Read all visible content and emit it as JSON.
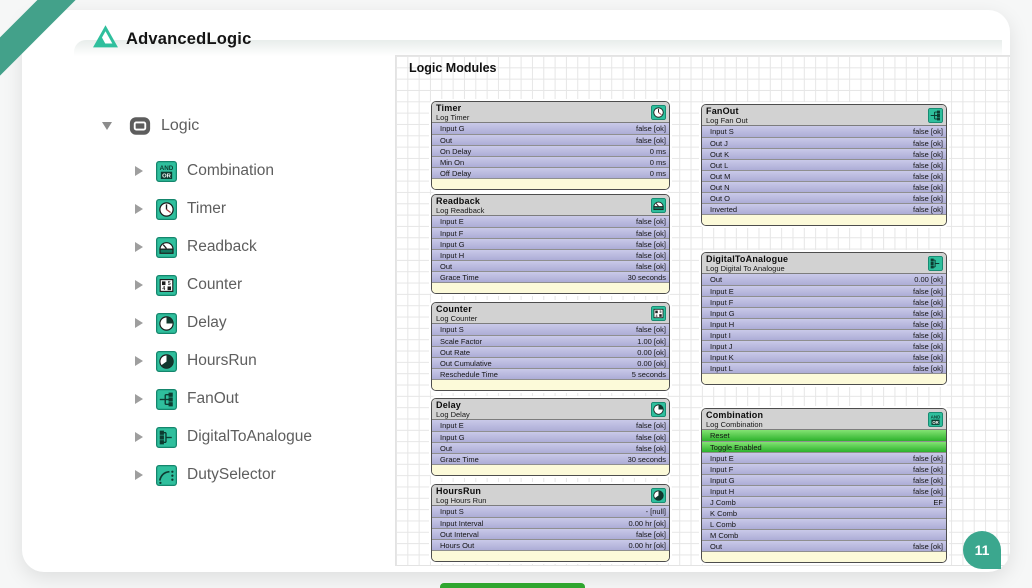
{
  "brand": {
    "name": "AdvancedLogic"
  },
  "slide": {
    "page_number": "11"
  },
  "tree": {
    "root": {
      "label": "Logic",
      "icon": "folder-icon"
    },
    "items": [
      {
        "label": "Combination",
        "icon": "andor-icon"
      },
      {
        "label": "Timer",
        "icon": "timer-icon"
      },
      {
        "label": "Readback",
        "icon": "readback-icon"
      },
      {
        "label": "Counter",
        "icon": "counter-icon"
      },
      {
        "label": "Delay",
        "icon": "delay-icon"
      },
      {
        "label": "HoursRun",
        "icon": "hoursrun-icon"
      },
      {
        "label": "FanOut",
        "icon": "fanout-icon"
      },
      {
        "label": "DigitalToAnalogue",
        "icon": "dta-icon"
      },
      {
        "label": "DutySelector",
        "icon": "dutyselector-icon"
      }
    ]
  },
  "canvas": {
    "title": "Logic Modules",
    "blocks": [
      {
        "name": "Timer",
        "subtitle": "Log Timer",
        "icon": "timer-icon",
        "rows": [
          {
            "label": "Input G",
            "value": "false [ok]"
          },
          {
            "label": "Out",
            "value": "false [ok]"
          },
          {
            "label": "On Delay",
            "value": "0 ms"
          },
          {
            "label": "Min On",
            "value": "0 ms"
          },
          {
            "label": "Off Delay",
            "value": "0 ms"
          }
        ]
      },
      {
        "name": "Readback",
        "subtitle": "Log Readback",
        "icon": "readback-icon",
        "rows": [
          {
            "label": "Input E",
            "value": "false [ok]"
          },
          {
            "label": "Input F",
            "value": "false [ok]"
          },
          {
            "label": "Input G",
            "value": "false [ok]"
          },
          {
            "label": "Input H",
            "value": "false [ok]"
          },
          {
            "label": "Out",
            "value": "false [ok]"
          },
          {
            "label": "Grace Time",
            "value": "30 seconds"
          }
        ]
      },
      {
        "name": "Counter",
        "subtitle": "Log Counter",
        "icon": "counter-icon",
        "rows": [
          {
            "label": "Input S",
            "value": "false [ok]"
          },
          {
            "label": "Scale Factor",
            "value": "1.00 [ok]"
          },
          {
            "label": "Out Rate",
            "value": "0.00 [ok]"
          },
          {
            "label": "Out Cumulative",
            "value": "0.00 [ok]"
          },
          {
            "label": "Reschedule Time",
            "value": "5 seconds"
          }
        ]
      },
      {
        "name": "Delay",
        "subtitle": "Log Delay",
        "icon": "delay-icon",
        "rows": [
          {
            "label": "Input E",
            "value": "false [ok]"
          },
          {
            "label": "Input G",
            "value": "false [ok]"
          },
          {
            "label": "Out",
            "value": "false [ok]"
          },
          {
            "label": "Grace Time",
            "value": "30 seconds"
          }
        ]
      },
      {
        "name": "HoursRun",
        "subtitle": "Log Hours Run",
        "icon": "hoursrun-icon",
        "rows": [
          {
            "label": "Input S",
            "value": "- [null]"
          },
          {
            "label": "Input Interval",
            "value": "0.00 hr [ok]"
          },
          {
            "label": "Out Interval",
            "value": "false [ok]"
          },
          {
            "label": "Hours Out",
            "value": "0.00 hr [ok]"
          }
        ]
      },
      {
        "name": "FanOut",
        "subtitle": "Log Fan Out",
        "icon": "fanout-icon",
        "rows": [
          {
            "label": "Input S",
            "value": "false [ok]"
          },
          {
            "label": "Out J",
            "value": "false [ok]"
          },
          {
            "label": "Out K",
            "value": "false [ok]"
          },
          {
            "label": "Out L",
            "value": "false [ok]"
          },
          {
            "label": "Out M",
            "value": "false [ok]"
          },
          {
            "label": "Out N",
            "value": "false [ok]"
          },
          {
            "label": "Out O",
            "value": "false [ok]"
          },
          {
            "label": "Inverted",
            "value": "false [ok]"
          }
        ]
      },
      {
        "name": "DigitalToAnalogue",
        "subtitle": "Log Digital To Analogue",
        "icon": "dta-icon",
        "rows": [
          {
            "label": "Out",
            "value": "0.00 [ok]"
          },
          {
            "label": "Input E",
            "value": "false [ok]"
          },
          {
            "label": "Input F",
            "value": "false [ok]"
          },
          {
            "label": "Input G",
            "value": "false [ok]"
          },
          {
            "label": "Input H",
            "value": "false [ok]"
          },
          {
            "label": "Input I",
            "value": "false [ok]"
          },
          {
            "label": "Input J",
            "value": "false [ok]"
          },
          {
            "label": "Input K",
            "value": "false [ok]"
          },
          {
            "label": "Input L",
            "value": "false [ok]"
          }
        ]
      },
      {
        "name": "Combination",
        "subtitle": "Log Combination",
        "icon": "andor-icon",
        "rows": [
          {
            "label": "Reset",
            "value": "",
            "style": "green"
          },
          {
            "label": "Toggle Enabled",
            "value": "",
            "style": "green"
          },
          {
            "label": "Input E",
            "value": "false [ok]"
          },
          {
            "label": "Input F",
            "value": "false [ok]"
          },
          {
            "label": "Input G",
            "value": "false [ok]"
          },
          {
            "label": "Input H",
            "value": "false [ok]"
          },
          {
            "label": "J Comb",
            "value": "EF"
          },
          {
            "label": "K Comb",
            "value": ""
          },
          {
            "label": "L Comb",
            "value": ""
          },
          {
            "label": "M Comb",
            "value": ""
          },
          {
            "label": "Out",
            "value": "false [ok]"
          }
        ]
      }
    ]
  },
  "colors": {
    "brand_teal": "#2fbf9d",
    "ribbon_teal": "#43a18a",
    "badge_teal": "#3ba78e",
    "row_purple": "#b3b3da",
    "row_green": "#3fcf3f",
    "footer_yellow": "#fcfad9"
  }
}
